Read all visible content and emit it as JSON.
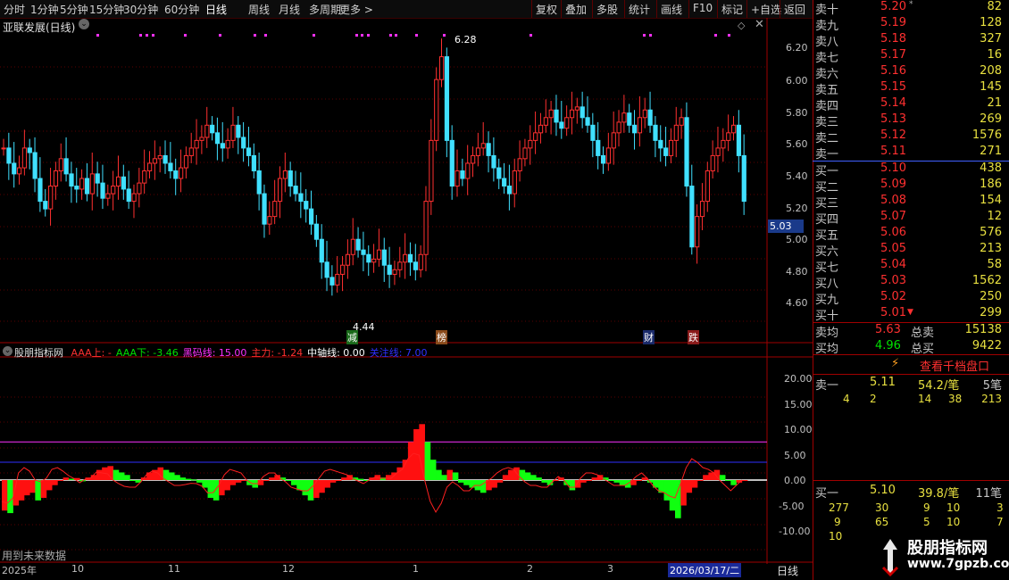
{
  "toolbar": {
    "periods": [
      "分时",
      "1分钟",
      "5分钟",
      "15分钟",
      "30分钟",
      "60分钟",
      "日线",
      "周线",
      "月线",
      "多周期",
      "更多 >"
    ],
    "selected": "日线",
    "actions": [
      "复权",
      "叠加",
      "多股",
      "统计",
      "画线",
      "F10",
      "标记",
      "+自选",
      "返回"
    ]
  },
  "chart": {
    "title": "亚联发展(日线)",
    "price_ticks": [
      "6.20",
      "6.00",
      "5.80",
      "5.60",
      "5.40",
      "5.20",
      "5.00",
      "4.80",
      "4.60"
    ],
    "current_price": "5.03",
    "high_label": "6.28",
    "low_label": "4.44",
    "markers": [
      "减",
      "榜",
      "财",
      "跌"
    ]
  },
  "indicator": {
    "name": "股朋指标网",
    "legend": [
      {
        "text": "AAA上: -",
        "color": "#ff3030"
      },
      {
        "text": "AAA下: -3.46",
        "color": "#00e000"
      },
      {
        "text": "黑码线: 15.00",
        "color": "#ff30ff"
      },
      {
        "text": "主力: -1.24",
        "color": "#ff3030"
      },
      {
        "text": "中轴线: 0.00",
        "color": "#ffffff"
      },
      {
        "text": "关注线: 7.00",
        "color": "#3030ff"
      }
    ],
    "ticks": [
      "20.00",
      "15.00",
      "10.00",
      "5.00",
      "0.00",
      "-5.00",
      "-10.00"
    ],
    "future_note": "用到未来数据"
  },
  "date_axis": {
    "labels": [
      "2025年",
      "10",
      "11",
      "12",
      "1",
      "2",
      "3"
    ],
    "cursor_date": "2026/03/17/二",
    "period": "日线"
  },
  "order_book": {
    "sell": [
      {
        "label": "卖十",
        "price": "5.20",
        "vol": "82",
        "extra": "*"
      },
      {
        "label": "卖九",
        "price": "5.19",
        "vol": "128"
      },
      {
        "label": "卖八",
        "price": "5.18",
        "vol": "327"
      },
      {
        "label": "卖七",
        "price": "5.17",
        "vol": "16"
      },
      {
        "label": "卖六",
        "price": "5.16",
        "vol": "208"
      },
      {
        "label": "卖五",
        "price": "5.15",
        "vol": "145"
      },
      {
        "label": "卖四",
        "price": "5.14",
        "vol": "21"
      },
      {
        "label": "卖三",
        "price": "5.13",
        "vol": "269"
      },
      {
        "label": "卖二",
        "price": "5.12",
        "vol": "1576"
      },
      {
        "label": "卖一",
        "price": "5.11",
        "vol": "271"
      }
    ],
    "buy": [
      {
        "label": "买一",
        "price": "5.10",
        "vol": "438"
      },
      {
        "label": "买二",
        "price": "5.09",
        "vol": "186"
      },
      {
        "label": "买三",
        "price": "5.08",
        "vol": "154"
      },
      {
        "label": "买四",
        "price": "5.07",
        "vol": "12"
      },
      {
        "label": "买五",
        "price": "5.06",
        "vol": "576"
      },
      {
        "label": "买六",
        "price": "5.05",
        "vol": "213"
      },
      {
        "label": "买七",
        "price": "5.04",
        "vol": "58"
      },
      {
        "label": "买八",
        "price": "5.03",
        "vol": "1562"
      },
      {
        "label": "买九",
        "price": "5.02",
        "vol": "250"
      },
      {
        "label": "买十",
        "price": "5.01",
        "vol": "299",
        "extra": "▼"
      }
    ],
    "avg_sell_label": "卖均",
    "avg_sell": "5.63",
    "total_sell_label": "总卖",
    "total_sell": "15138",
    "avg_buy_label": "买均",
    "avg_buy": "4.96",
    "total_buy_label": "总买",
    "total_buy": "9422",
    "thousand_btn": "查看千档盘口",
    "sell1": {
      "label": "卖一",
      "price": "5.11",
      "avg": "54.2/笔",
      "count": "5笔",
      "orders": [
        "4",
        "2",
        "14",
        "38",
        "213"
      ]
    },
    "buy1": {
      "label": "买一",
      "price": "5.10",
      "avg": "39.8/笔",
      "count": "11笔",
      "orders_row1": [
        "277",
        "30",
        "9",
        "10",
        "3"
      ],
      "orders_row2": [
        "9",
        "65",
        "5",
        "10",
        "7"
      ],
      "orders_row3": [
        "10"
      ]
    }
  },
  "watermark": {
    "name": "股朋指标网",
    "url": "www.7gpzb.com"
  }
}
